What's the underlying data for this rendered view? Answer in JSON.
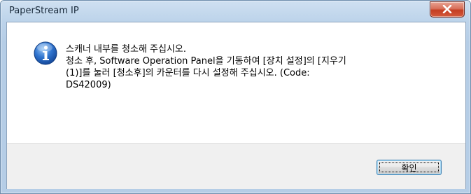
{
  "window": {
    "title": "PaperStream IP",
    "close_icon": "close-x-icon"
  },
  "dialog": {
    "icon": "information-icon",
    "message_lines": [
      "스캐너 내부를 청소해 주십시오.",
      "청소 후, Software Operation Panel을 기동하여 [장치 설정]의 [지우기",
      "(1)]를 눌러 [청소후]의 카운터를 다시 설정해 주십시오. (Code:",
      "DS42009)"
    ]
  },
  "buttons": {
    "ok_label": "확인"
  },
  "colors": {
    "titlebar": "#bcd3ea",
    "close_button": "#c43d22",
    "info_icon": "#1f5fb6",
    "footer": "#f0f0f0"
  }
}
